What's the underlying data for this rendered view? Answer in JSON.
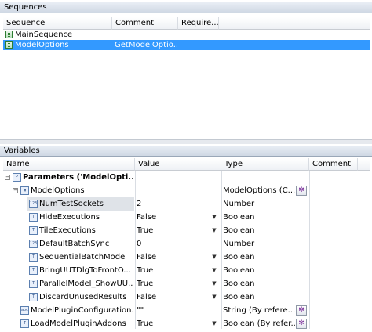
{
  "sequences": {
    "title": "Sequences",
    "columns": [
      "Sequence",
      "Comment",
      "Require..."
    ],
    "rows": [
      {
        "name": "MainSequence",
        "comment": "",
        "selected": false
      },
      {
        "name": "ModelOptions",
        "comment": "GetModelOptio...",
        "selected": true
      }
    ]
  },
  "variables": {
    "title": "Variables",
    "columns": [
      "Name",
      "Value",
      "Type",
      "Comment"
    ],
    "rows": [
      {
        "name": "Parameters ('ModelOpti...",
        "value": "",
        "type": "",
        "icon": "parameters-icon"
      },
      {
        "name": "ModelOptions",
        "value": "",
        "type": "ModelOptions (C...",
        "icon": "container-icon"
      },
      {
        "name": "NumTestSockets",
        "value": "2",
        "type": "Number",
        "icon": "number-icon"
      },
      {
        "name": "HideExecutions",
        "value": "False",
        "type": "Boolean",
        "icon": "boolean-icon"
      },
      {
        "name": "TileExecutions",
        "value": "True",
        "type": "Boolean",
        "icon": "boolean-icon"
      },
      {
        "name": "DefaultBatchSync",
        "value": "0",
        "type": "Number",
        "icon": "number-icon"
      },
      {
        "name": "SequentialBatchMode",
        "value": "False",
        "type": "Boolean",
        "icon": "boolean-icon"
      },
      {
        "name": "BringUUTDlgToFrontO...",
        "value": "True",
        "type": "Boolean",
        "icon": "boolean-icon"
      },
      {
        "name": "ParallelModel_ShowUU...",
        "value": "True",
        "type": "Boolean",
        "icon": "boolean-icon"
      },
      {
        "name": "DiscardUnusedResults",
        "value": "False",
        "type": "Boolean",
        "icon": "boolean-icon"
      },
      {
        "name": "ModelPluginConfiguration...",
        "value": "\"\"",
        "type": "String (By refere...",
        "icon": "string-icon"
      },
      {
        "name": "LoadModelPluginAddons",
        "value": "True",
        "type": "Boolean (By refer...",
        "icon": "boolean-icon"
      }
    ]
  },
  "colors": {
    "selection": "#3399ff",
    "panel_header": "#cfd8e4"
  }
}
